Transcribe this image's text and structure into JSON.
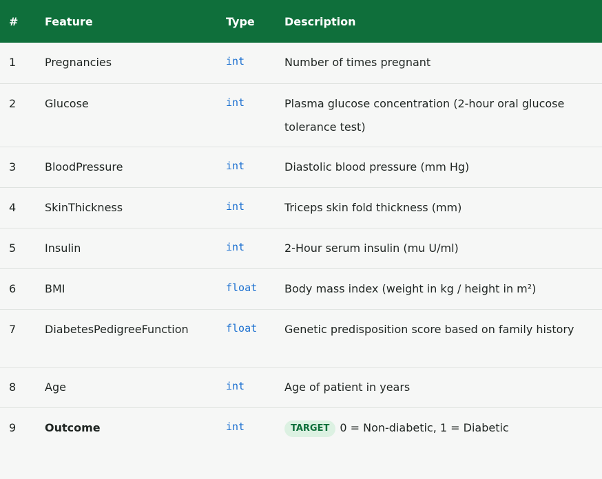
{
  "header": {
    "num": "#",
    "feature": "Feature",
    "type": "Type",
    "description": "Description"
  },
  "rows": [
    {
      "num": "1",
      "feature": "Pregnancies",
      "type": "int",
      "description": "Number of times pregnant"
    },
    {
      "num": "2",
      "feature": "Glucose",
      "type": "int",
      "description": "Plasma glucose concentration (2-hour oral glucose tolerance test)"
    },
    {
      "num": "3",
      "feature": "BloodPressure",
      "type": "int",
      "description": "Diastolic blood pressure (mm Hg)"
    },
    {
      "num": "4",
      "feature": "SkinThickness",
      "type": "int",
      "description": "Triceps skin fold thickness (mm)"
    },
    {
      "num": "5",
      "feature": "Insulin",
      "type": "int",
      "description": "2-Hour serum insulin (mu U/ml)"
    },
    {
      "num": "6",
      "feature": "BMI",
      "type": "float",
      "description": "Body mass index (weight in kg / height in m²)"
    },
    {
      "num": "7",
      "feature": "DiabetesPedigreeFunction",
      "type": "float",
      "description": "Genetic predisposition score based on family history"
    },
    {
      "num": "8",
      "feature": "Age",
      "type": "int",
      "description": "Age of patient in years"
    },
    {
      "num": "9",
      "feature": "Outcome",
      "type": "int",
      "badge": "TARGET",
      "description": "0 = Non-diabetic, 1 = Diabetic"
    }
  ],
  "colors": {
    "header_bg": "#0f6f3b",
    "type_text": "#1a6fd0",
    "badge_bg": "#dcf1e2",
    "badge_text": "#0f6f3b"
  }
}
